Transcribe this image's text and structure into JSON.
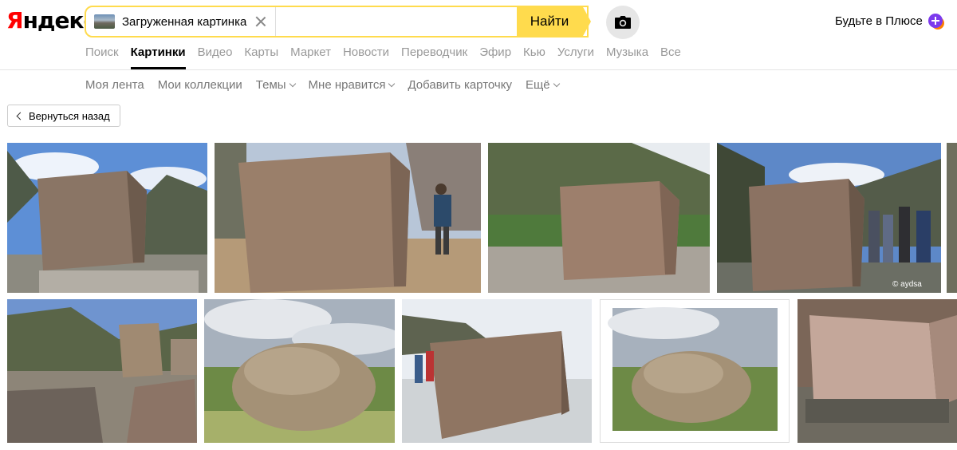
{
  "header": {
    "logo": "Яндекс",
    "logo_first": "Я",
    "logo_rest": "ндекс",
    "search_chip_label": "Загруженная картинка",
    "search_value": "",
    "search_button": "Найти",
    "plus_label": "Будьте в Плюсе"
  },
  "tabs": [
    {
      "label": "Поиск",
      "active": false
    },
    {
      "label": "Картинки",
      "active": true
    },
    {
      "label": "Видео",
      "active": false
    },
    {
      "label": "Карты",
      "active": false
    },
    {
      "label": "Маркет",
      "active": false
    },
    {
      "label": "Новости",
      "active": false
    },
    {
      "label": "Переводчик",
      "active": false
    },
    {
      "label": "Эфир",
      "active": false
    },
    {
      "label": "Кью",
      "active": false
    },
    {
      "label": "Услуги",
      "active": false
    },
    {
      "label": "Музыка",
      "active": false
    },
    {
      "label": "Все",
      "active": false
    }
  ],
  "subnav": [
    {
      "label": "Моя лента",
      "dropdown": false
    },
    {
      "label": "Мои коллекции",
      "dropdown": false
    },
    {
      "label": "Темы",
      "dropdown": true
    },
    {
      "label": "Мне нравится",
      "dropdown": true
    },
    {
      "label": "Добавить карточку",
      "dropdown": false
    },
    {
      "label": "Ещё",
      "dropdown": true
    }
  ],
  "back_button": "Вернуться назад",
  "watermark": "© aydsa",
  "colors": {
    "accent": "#ffdb4d",
    "logo_red": "#ff0000",
    "plus": "#7c3aed"
  }
}
